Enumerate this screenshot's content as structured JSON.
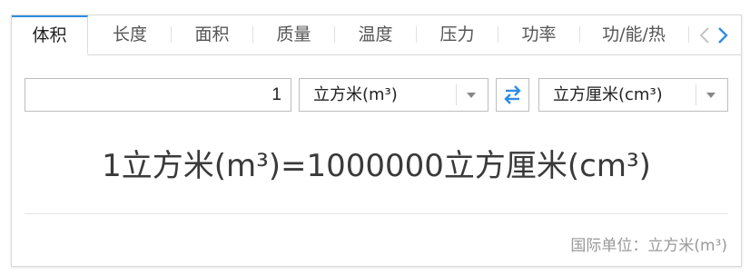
{
  "tabs": [
    {
      "label": "体积",
      "active": true
    },
    {
      "label": "长度",
      "active": false
    },
    {
      "label": "面积",
      "active": false
    },
    {
      "label": "质量",
      "active": false
    },
    {
      "label": "温度",
      "active": false
    },
    {
      "label": "压力",
      "active": false
    },
    {
      "label": "功率",
      "active": false
    },
    {
      "label": "功/能/热",
      "active": false
    }
  ],
  "nav": {
    "prev_icon": "chevron-left",
    "next_icon": "chevron-right"
  },
  "converter": {
    "input_value": "1",
    "from_unit": "立方米(m³)",
    "to_unit": "立方厘米(cm³)",
    "swap_icon": "swap-arrows"
  },
  "result": {
    "text": "1立方米(m³)=1000000立方厘米(cm³)"
  },
  "footer": {
    "text": "国际单位：立方米(m³)"
  },
  "colors": {
    "accent": "#2f8de4",
    "border": "#bdbdbd",
    "muted": "#999999"
  }
}
